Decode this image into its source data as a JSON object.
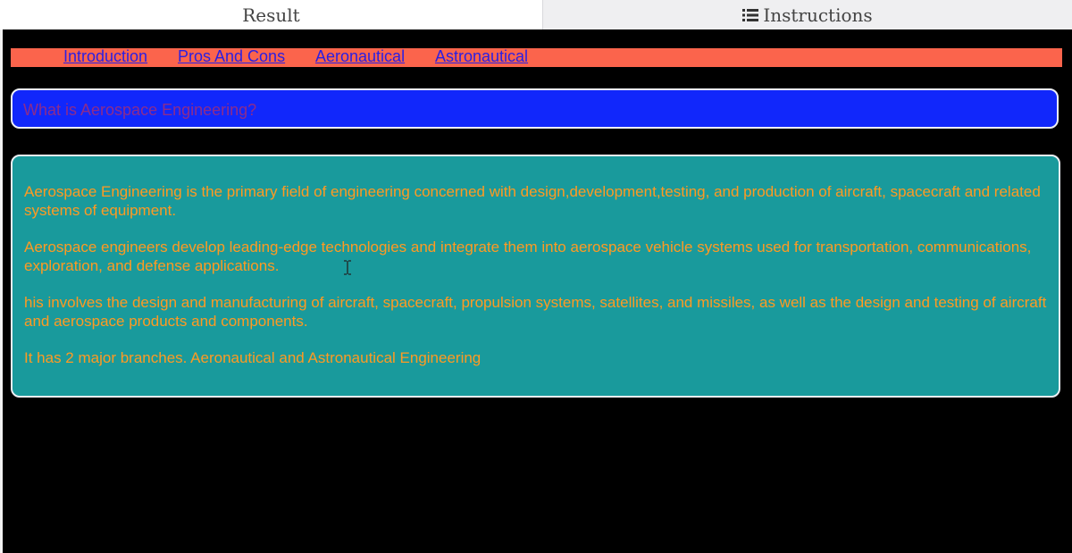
{
  "tabs": {
    "result_label": "Result",
    "instructions_label": "Instructions",
    "instructions_icon": "list-icon"
  },
  "nav": {
    "items": [
      {
        "label": "Introduction"
      },
      {
        "label": "Pros And Cons"
      },
      {
        "label": "Aeronautical"
      },
      {
        "label": "Astronautical"
      }
    ]
  },
  "hero": {
    "title": "What is Aerospace Engineering?"
  },
  "content": {
    "paragraphs": [
      "Aerospace Engineering is the primary field of engineering concerned with design,development,testing, and production of aircraft, spacecraft and related systems of equipment.",
      "Aerospace engineers develop leading-edge technologies and integrate them into aerospace vehicle systems used for transportation, communications, exploration, and defense applications.",
      "his involves the design and manufacturing of aircraft, spacecraft, propulsion systems, satellites, and missiles, as well as the design and testing of aircraft and aerospace products and components.",
      "It has 2 major branches. Aeronautical and Astronautical Engineering"
    ]
  },
  "colors": {
    "nav_background": "#fb644c",
    "nav_link": "#2a1fe3",
    "hero_background": "#1127fb",
    "hero_text": "#8c2c8c",
    "content_background": "#199a9c",
    "content_text": "#ff9a22",
    "page_background": "#000000"
  }
}
